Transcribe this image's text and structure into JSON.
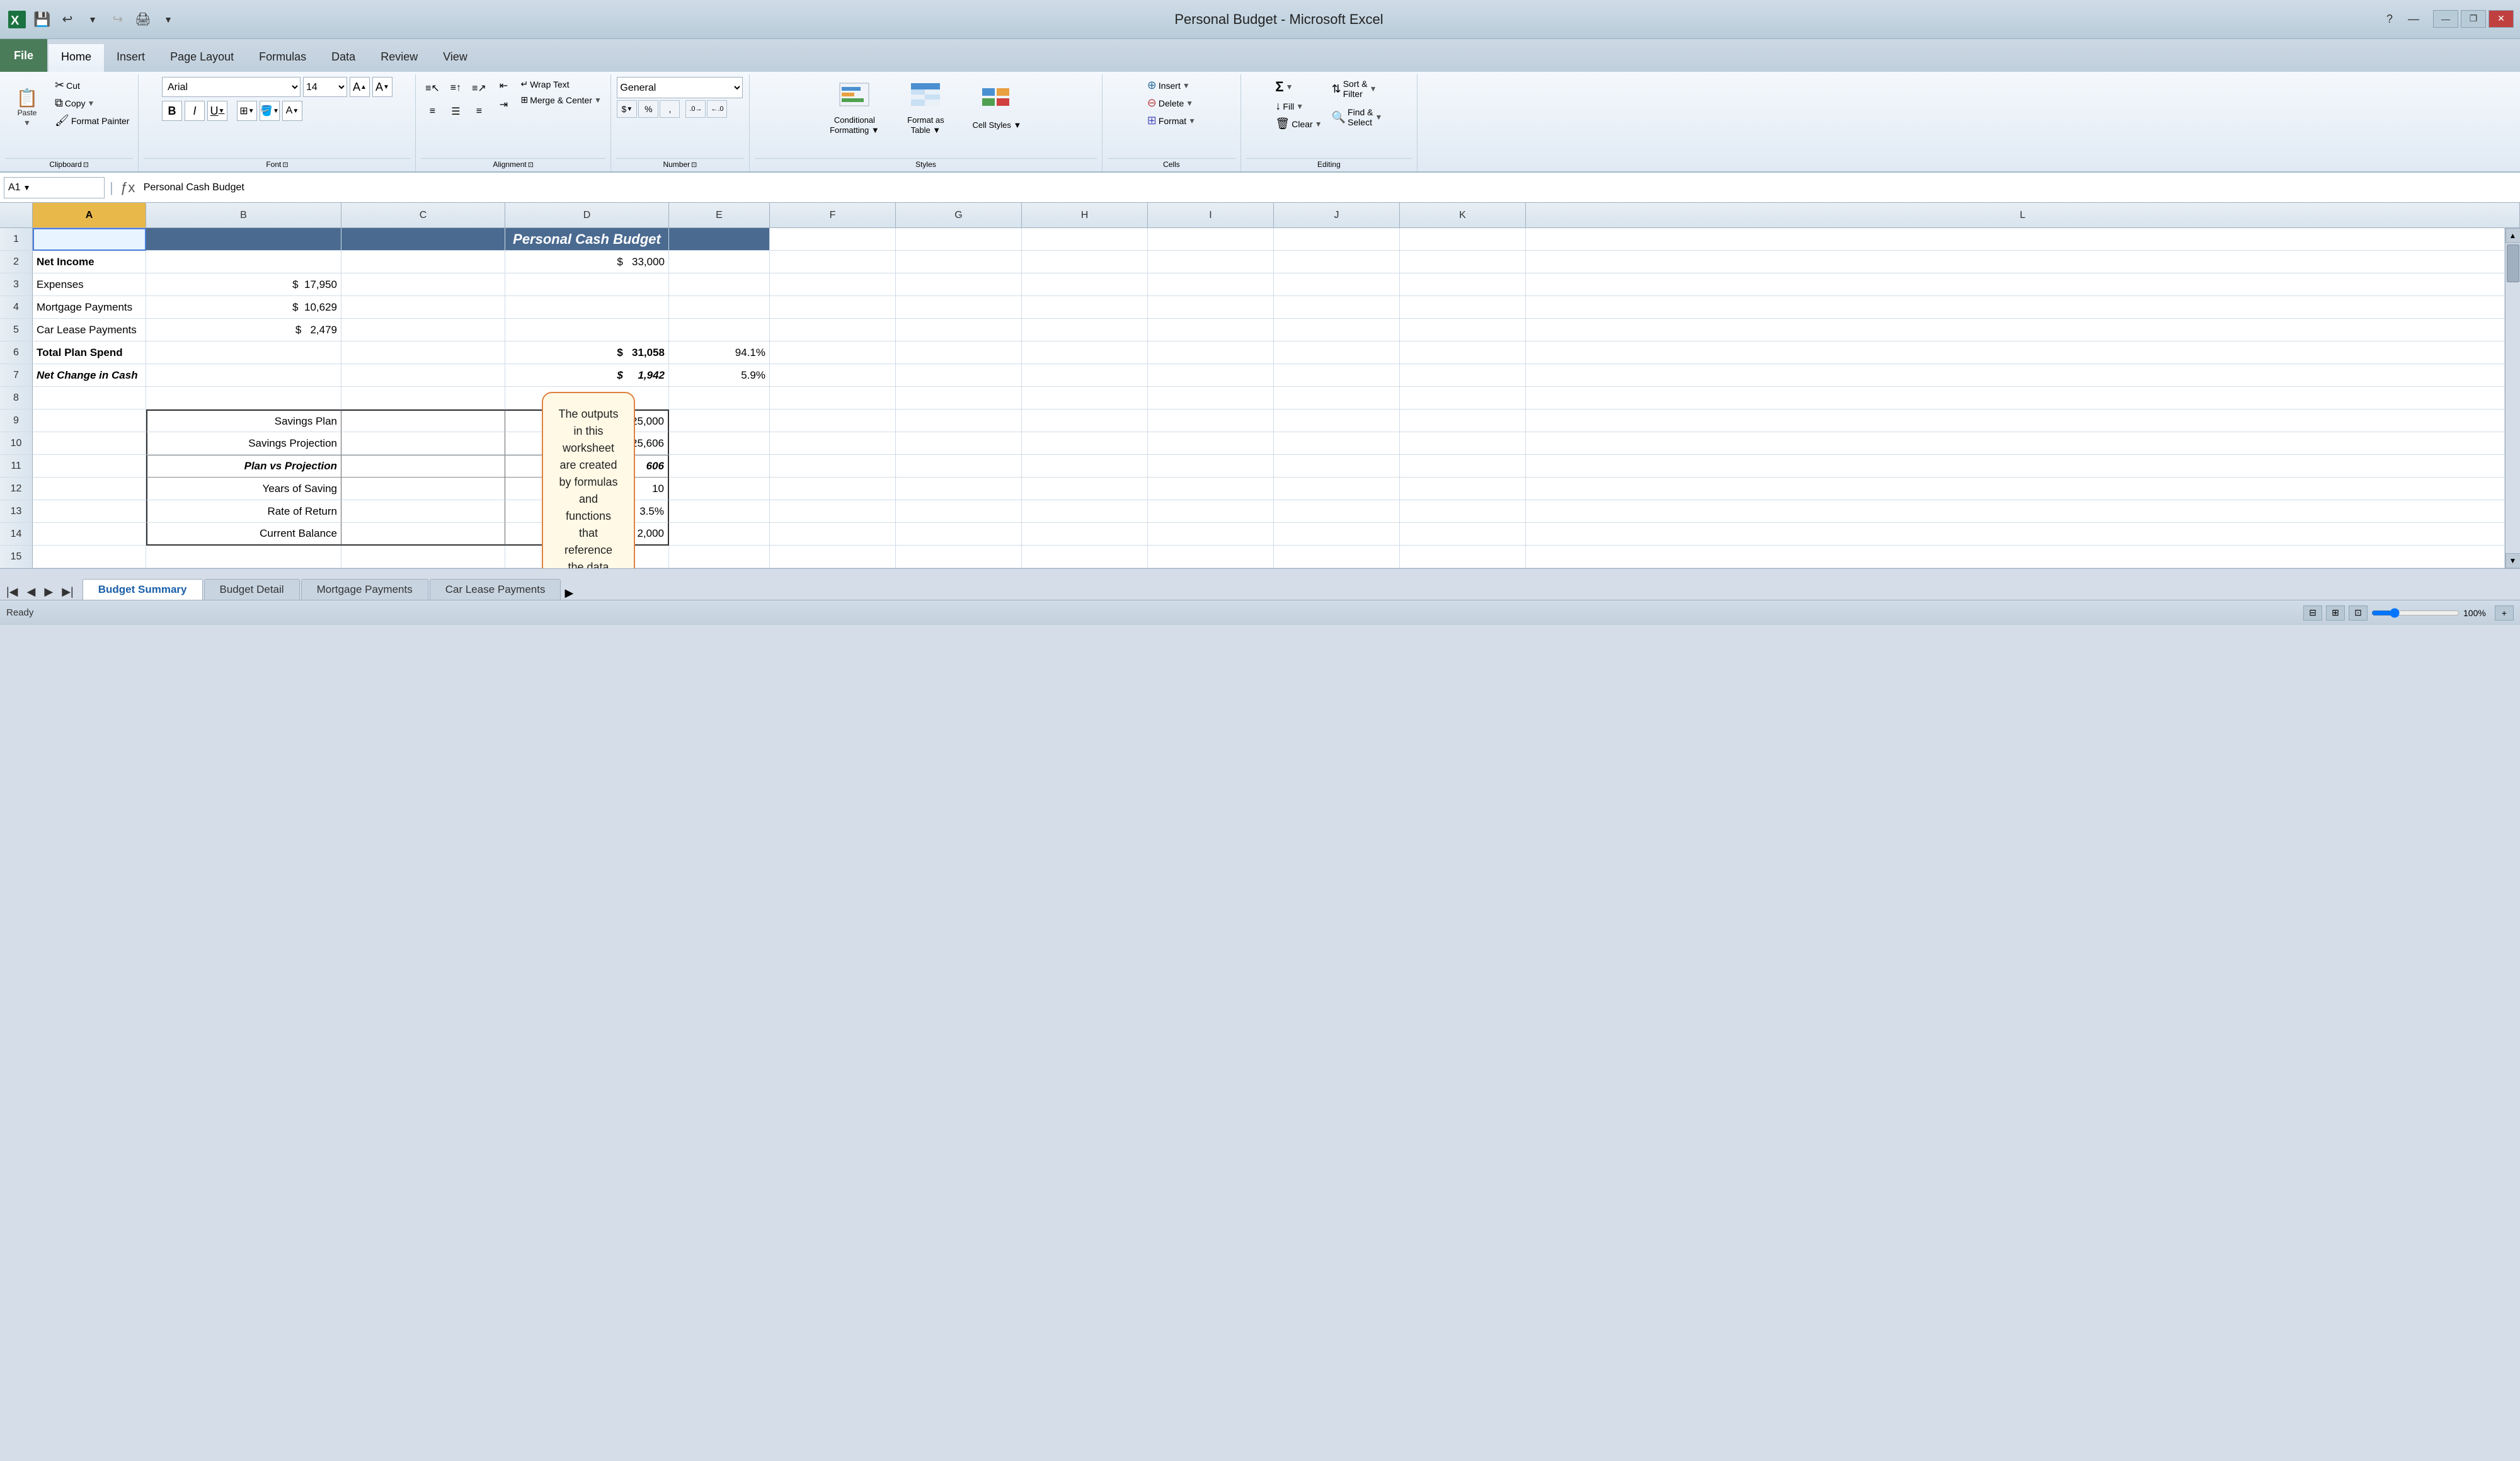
{
  "app": {
    "title": "Personal Budget - Microsoft Excel"
  },
  "title_bar": {
    "quick_access": [
      "💾",
      "↩",
      "↪",
      "🖨"
    ],
    "min": "—",
    "restore": "❐",
    "close": "✕",
    "title": "Personal Budget - Microsoft Excel"
  },
  "ribbon": {
    "tabs": [
      "File",
      "Home",
      "Insert",
      "Page Layout",
      "Formulas",
      "Data",
      "Review",
      "View"
    ],
    "active_tab": "Home",
    "groups": {
      "clipboard": {
        "label": "Clipboard",
        "paste_label": "Paste",
        "cut_label": "Cut",
        "copy_label": "Copy",
        "format_painter_label": "Format Painter"
      },
      "font": {
        "label": "Font",
        "font_name": "Arial",
        "font_size": "14",
        "bold": "B",
        "italic": "I",
        "underline": "U",
        "increase_font": "A↑",
        "decrease_font": "A↓",
        "borders": "⊞",
        "fill_color": "A",
        "font_color": "A"
      },
      "alignment": {
        "label": "Alignment",
        "wrap_text": "Wrap Text",
        "merge_center": "Merge & Center"
      },
      "number": {
        "label": "Number",
        "format": "General",
        "dollar": "$",
        "percent": "%",
        "comma": ",",
        "increase_decimal": ".0→.00",
        "decrease_decimal": ".00→.0"
      },
      "styles": {
        "label": "Styles",
        "conditional_formatting": "Conditional\nFormatting",
        "format_as_table": "Format as\nTable",
        "cell_styles": "Cell Styles"
      },
      "cells": {
        "label": "Cells",
        "insert": "Insert",
        "delete": "Delete",
        "format": "Format"
      },
      "editing": {
        "label": "Editing",
        "autosum": "Σ",
        "fill": "Fill",
        "clear": "Clear",
        "sort_filter": "Sort &\nFilter",
        "find_select": "Find &\nSelect"
      }
    }
  },
  "formula_bar": {
    "name_box": "A1",
    "formula": "Personal Cash Budget"
  },
  "columns": {
    "widths": [
      180,
      310,
      260,
      260,
      160,
      200,
      200,
      200,
      200,
      200,
      200,
      200
    ],
    "labels": [
      "A",
      "B",
      "C",
      "D",
      "E",
      "F",
      "G",
      "H",
      "I",
      "J",
      "K",
      "L"
    ]
  },
  "rows": [
    {
      "num": 1,
      "cells": [
        {
          "col": "A",
          "value": "Personal Cash Budget",
          "style": "header",
          "colspan": 5
        },
        {
          "col": "B",
          "value": ""
        },
        {
          "col": "C",
          "value": ""
        },
        {
          "col": "D",
          "value": ""
        },
        {
          "col": "E",
          "value": ""
        }
      ]
    },
    {
      "num": 2,
      "cells": [
        {
          "col": "A",
          "value": "Net Income",
          "style": "bold"
        },
        {
          "col": "B",
          "value": ""
        },
        {
          "col": "C",
          "value": ""
        },
        {
          "col": "D",
          "value": "$   33,000",
          "style": "right"
        },
        {
          "col": "E",
          "value": ""
        }
      ]
    },
    {
      "num": 3,
      "cells": [
        {
          "col": "A",
          "value": "Expenses"
        },
        {
          "col": "B",
          "value": "$  17,950",
          "style": "right"
        },
        {
          "col": "C",
          "value": ""
        },
        {
          "col": "D",
          "value": ""
        },
        {
          "col": "E",
          "value": ""
        }
      ]
    },
    {
      "num": 4,
      "cells": [
        {
          "col": "A",
          "value": "Mortgage Payments"
        },
        {
          "col": "B",
          "value": "$  10,629",
          "style": "right"
        },
        {
          "col": "C",
          "value": ""
        },
        {
          "col": "D",
          "value": ""
        },
        {
          "col": "E",
          "value": ""
        }
      ]
    },
    {
      "num": 5,
      "cells": [
        {
          "col": "A",
          "value": "Car Lease Payments"
        },
        {
          "col": "B",
          "value": "$    2,479",
          "style": "right"
        },
        {
          "col": "C",
          "value": ""
        },
        {
          "col": "D",
          "value": ""
        },
        {
          "col": "E",
          "value": ""
        }
      ]
    },
    {
      "num": 6,
      "cells": [
        {
          "col": "A",
          "value": "Total Plan Spend",
          "style": "bold"
        },
        {
          "col": "B",
          "value": ""
        },
        {
          "col": "C",
          "value": ""
        },
        {
          "col": "D",
          "value": "$   31,058",
          "style": "right bold"
        },
        {
          "col": "E",
          "value": "94.1%",
          "style": "right"
        }
      ]
    },
    {
      "num": 7,
      "cells": [
        {
          "col": "A",
          "value": "Net Change in Cash",
          "style": "bold italic"
        },
        {
          "col": "B",
          "value": ""
        },
        {
          "col": "C",
          "value": ""
        },
        {
          "col": "D",
          "value": "$     1,942",
          "style": "right bold italic"
        },
        {
          "col": "E",
          "value": "5.9%",
          "style": "right"
        }
      ]
    },
    {
      "num": 8,
      "cells": []
    },
    {
      "num": 9,
      "cells": [
        {
          "col": "A",
          "value": ""
        },
        {
          "col": "B",
          "value": "Savings Plan",
          "style": "right bordered"
        },
        {
          "col": "C",
          "value": ""
        },
        {
          "col": "D",
          "value": "$   25,000",
          "style": "right bordered"
        },
        {
          "col": "E",
          "value": ""
        }
      ]
    },
    {
      "num": 10,
      "cells": [
        {
          "col": "A",
          "value": ""
        },
        {
          "col": "B",
          "value": "Savings Projection",
          "style": "right bordered"
        },
        {
          "col": "C",
          "value": ""
        },
        {
          "col": "D",
          "value": "$   25,606",
          "style": "right bordered"
        },
        {
          "col": "E",
          "value": ""
        }
      ]
    },
    {
      "num": 11,
      "cells": [
        {
          "col": "A",
          "value": ""
        },
        {
          "col": "B",
          "value": "Plan vs Projection",
          "style": "right bold italic bordered"
        },
        {
          "col": "C",
          "value": ""
        },
        {
          "col": "D",
          "value": "$          606",
          "style": "right bold italic bordered"
        },
        {
          "col": "E",
          "value": ""
        }
      ]
    },
    {
      "num": 12,
      "cells": [
        {
          "col": "A",
          "value": ""
        },
        {
          "col": "B",
          "value": "Years of Saving",
          "style": "right bordered"
        },
        {
          "col": "C",
          "value": ""
        },
        {
          "col": "D",
          "value": "10",
          "style": "right bordered"
        },
        {
          "col": "E",
          "value": ""
        }
      ]
    },
    {
      "num": 13,
      "cells": [
        {
          "col": "A",
          "value": ""
        },
        {
          "col": "B",
          "value": "Rate of Return",
          "style": "right bordered"
        },
        {
          "col": "C",
          "value": ""
        },
        {
          "col": "D",
          "value": "3.5%",
          "style": "right bordered"
        },
        {
          "col": "E",
          "value": ""
        }
      ]
    },
    {
      "num": 14,
      "cells": [
        {
          "col": "A",
          "value": ""
        },
        {
          "col": "B",
          "value": "Current Balance",
          "style": "right bordered"
        },
        {
          "col": "C",
          "value": ""
        },
        {
          "col": "D",
          "value": "$     2,000",
          "style": "right bordered"
        },
        {
          "col": "E",
          "value": ""
        }
      ]
    },
    {
      "num": 15,
      "cells": []
    }
  ],
  "callout": {
    "text": "The outputs in this worksheet are created by formulas and functions that reference the data entered in these worksheets."
  },
  "sheet_tabs": [
    {
      "label": "Budget Summary",
      "active": true
    },
    {
      "label": "Budget Detail"
    },
    {
      "label": "Mortgage Payments"
    },
    {
      "label": "Car Lease Payments"
    }
  ],
  "status_bar": {
    "ready": "Ready"
  }
}
